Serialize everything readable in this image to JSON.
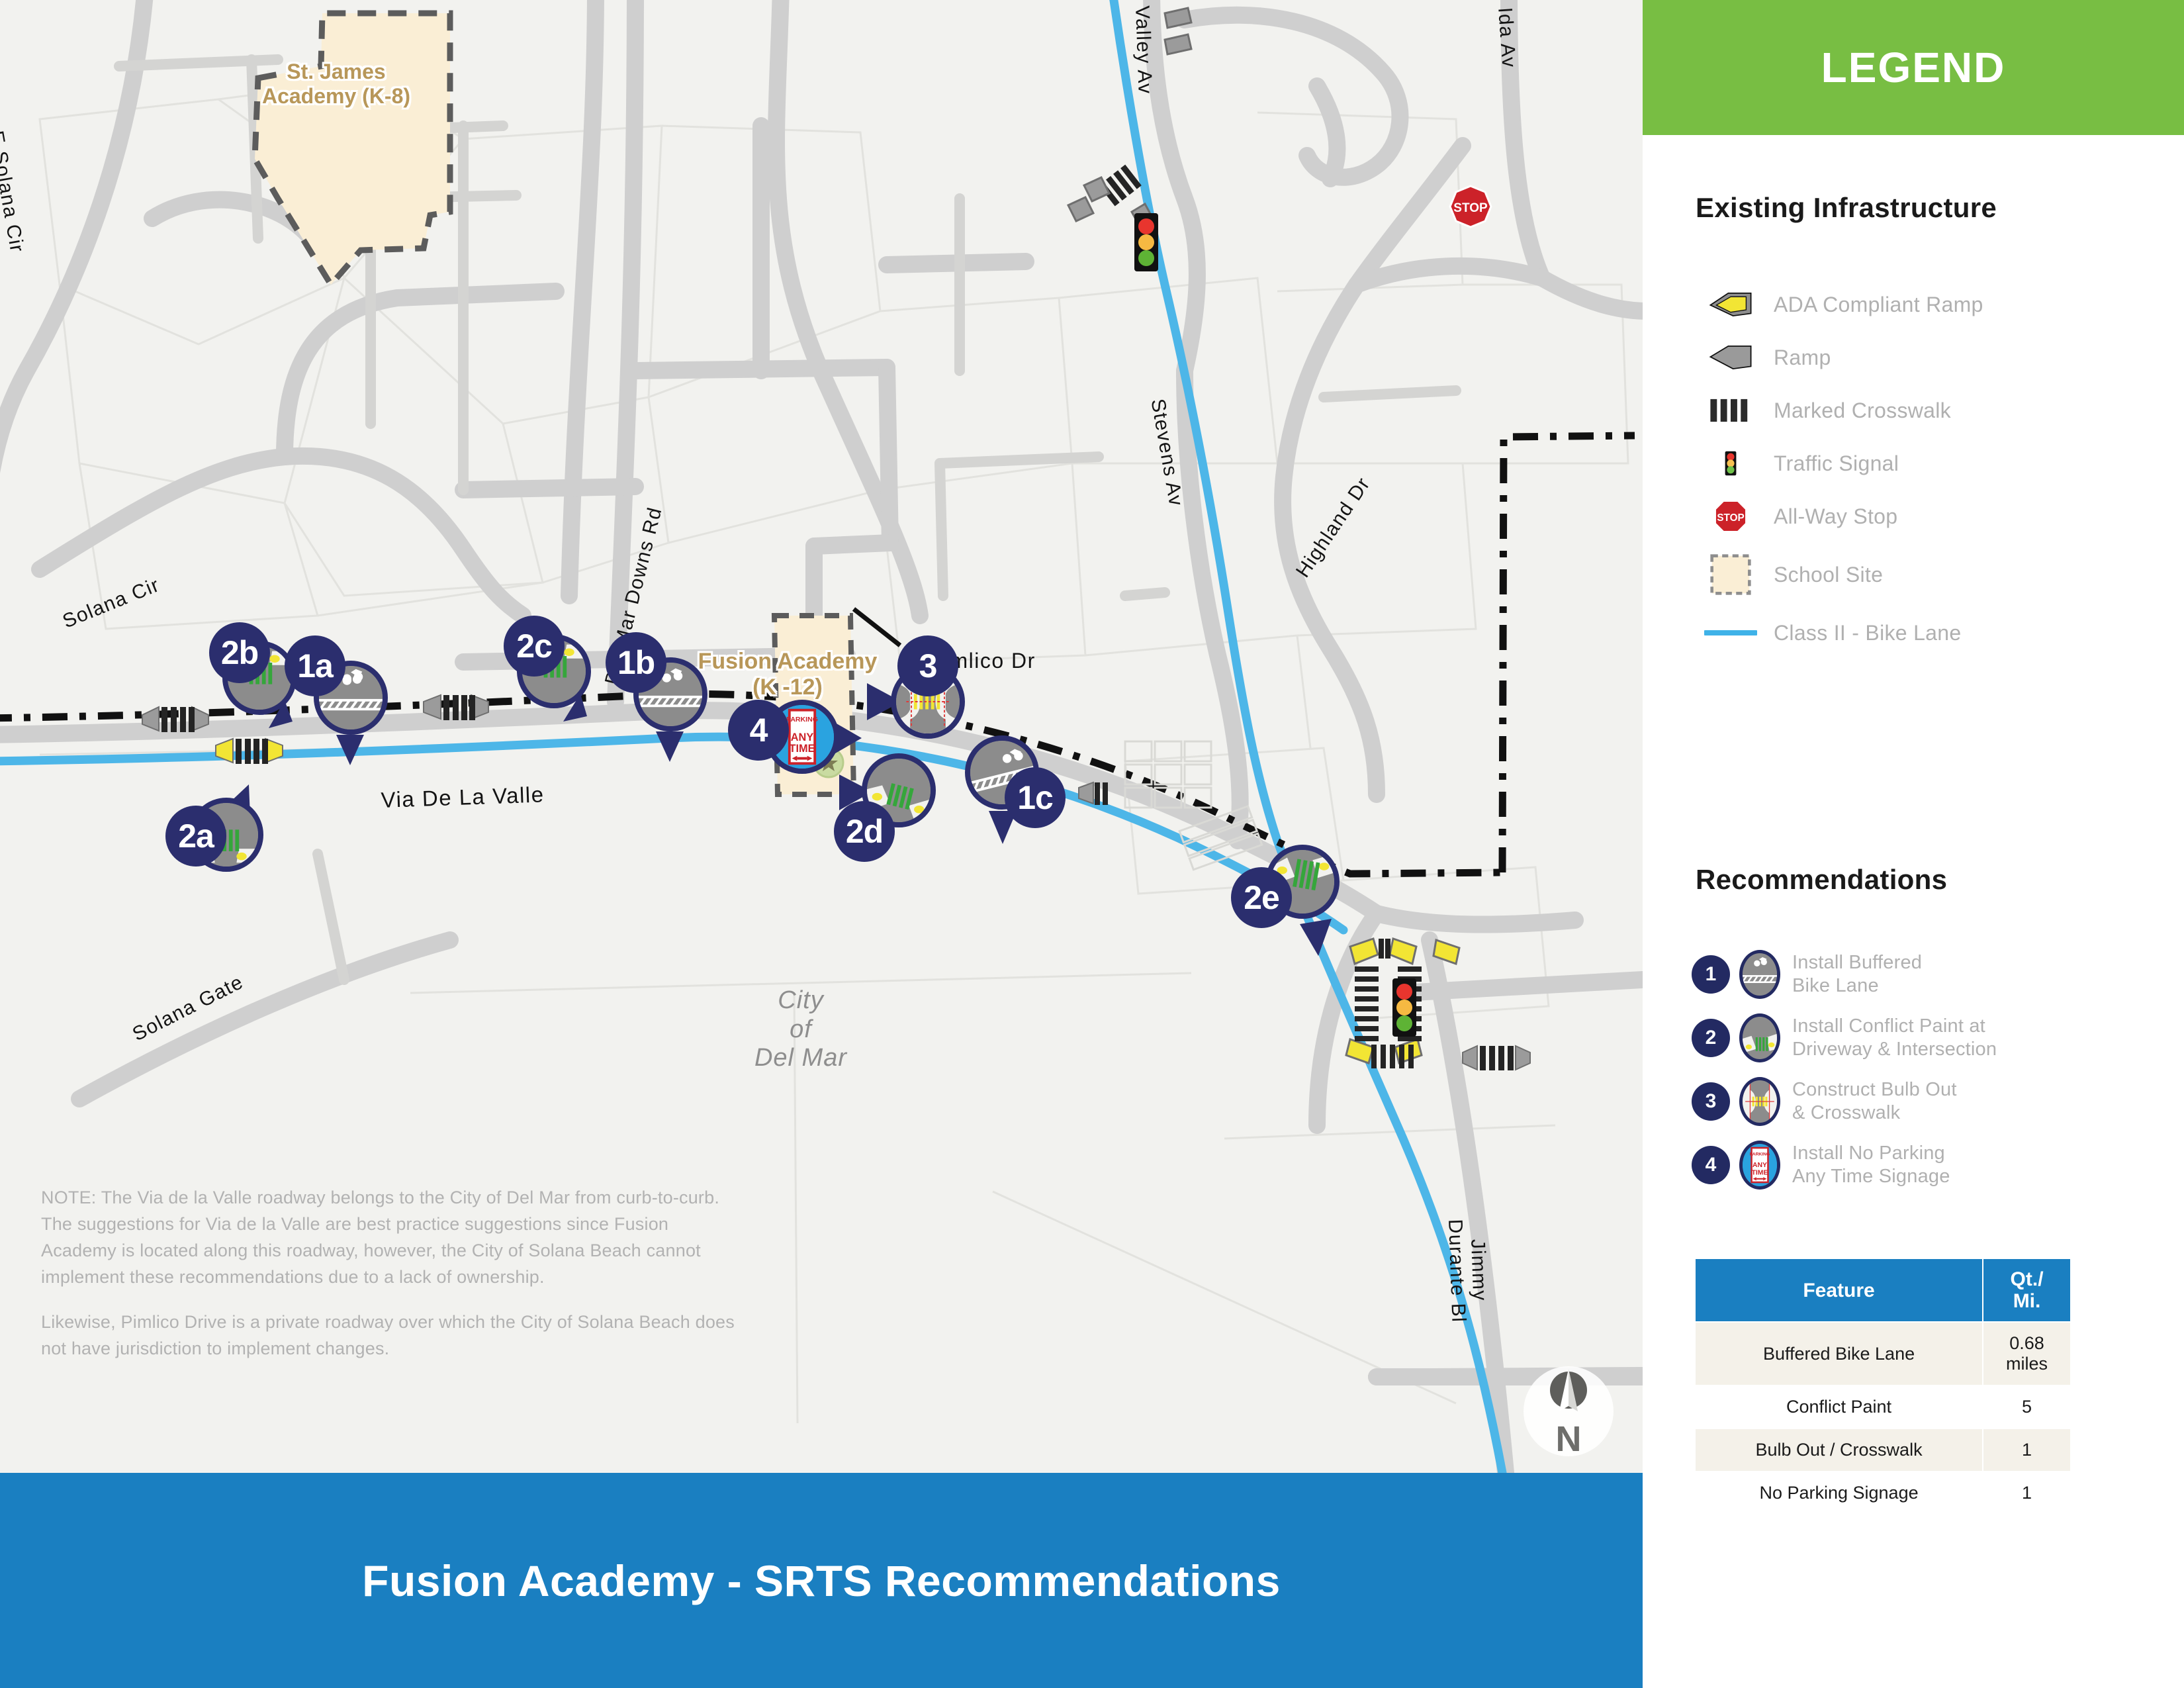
{
  "footer": {
    "title": "Fusion Academy - SRTS Recommendations"
  },
  "legend": {
    "header_title": "LEGEND",
    "existing_title": "Existing Infrastructure",
    "existing_items": [
      {
        "icon": "ada-ramp-icon",
        "label": "ADA Compliant Ramp"
      },
      {
        "icon": "ramp-icon",
        "label": "Ramp"
      },
      {
        "icon": "marked-crosswalk-icon",
        "label": "Marked Crosswalk"
      },
      {
        "icon": "traffic-signal-icon",
        "label": "Traffic Signal"
      },
      {
        "icon": "all-way-stop-icon",
        "label": "All-Way Stop"
      },
      {
        "icon": "school-site-icon",
        "label": "School Site"
      },
      {
        "icon": "bike-lane-line-icon",
        "label": "Class II - Bike Lane"
      }
    ],
    "recs_title": "Recommendations",
    "recommendations": [
      {
        "num": "1",
        "icon": "buffered-bike-lane-icon",
        "label": "Install Buffered\nBike Lane"
      },
      {
        "num": "2",
        "icon": "conflict-paint-icon",
        "label": "Install Conflict Paint at\nDriveway & Intersection"
      },
      {
        "num": "3",
        "icon": "bulb-out-crosswalk-icon",
        "label": "Construct Bulb Out\n& Crosswalk"
      },
      {
        "num": "4",
        "icon": "no-parking-sign-icon",
        "label": "Install No Parking\nAny Time Signage"
      }
    ],
    "table": {
      "headers": [
        "Feature",
        "Qt./\nMi."
      ],
      "rows": [
        {
          "feature": "Buffered Bike Lane",
          "qty": "0.68\nmiles"
        },
        {
          "feature": "Conflict Paint",
          "qty": "5"
        },
        {
          "feature": "Bulb Out / Crosswalk",
          "qty": "1"
        },
        {
          "feature": "No Parking Signage",
          "qty": "1"
        }
      ]
    }
  },
  "map": {
    "schools": [
      {
        "name": "St. James\nAcademy (K-8)"
      },
      {
        "name": "Fusion Academy\n(K -12)"
      }
    ],
    "city_label": "City\nof\nDel Mar",
    "roads": [
      "E Solana Cir",
      "Solana Cir",
      "Solana Gate",
      "Via De La Valle",
      "Del Mar Downs Rd",
      "Pimlico Dr",
      "Valley Av",
      "Stevens Av",
      "Highland Dr",
      "Ida Av",
      "Jimmy\nDurante Bl"
    ],
    "markers": [
      {
        "id": "2b",
        "type": "conflict-paint"
      },
      {
        "id": "1a",
        "type": "buffered-bike-lane"
      },
      {
        "id": "2a",
        "type": "conflict-paint"
      },
      {
        "id": "2c",
        "type": "conflict-paint"
      },
      {
        "id": "1b",
        "type": "buffered-bike-lane"
      },
      {
        "id": "4",
        "type": "no-parking-sign"
      },
      {
        "id": "3",
        "type": "bulb-out-crosswalk"
      },
      {
        "id": "2d",
        "type": "conflict-paint"
      },
      {
        "id": "1c",
        "type": "buffered-bike-lane"
      },
      {
        "id": "2e",
        "type": "conflict-paint"
      }
    ],
    "note_paragraphs": [
      "NOTE: The Via de la Valle roadway belongs to the City of Del Mar from curb-to-curb. The suggestions for Via de la Valle are best practice suggestions since Fusion Academy is located along this roadway, however, the City of Solana Beach cannot implement these recommendations due to a lack of ownership.",
      "Likewise, Pimlico Drive is a private roadway over which the City of Solana Beach does not have jurisdiction to implement changes."
    ],
    "compass_label": "N"
  },
  "colors": {
    "legend_header_green": "#78be43",
    "footer_blue": "#1a7fc1",
    "marker_navy": "#2b2e6e",
    "school_tan": "#faeed5",
    "bike_lane_blue": "#4db6e8",
    "stop_red": "#cc2229"
  }
}
